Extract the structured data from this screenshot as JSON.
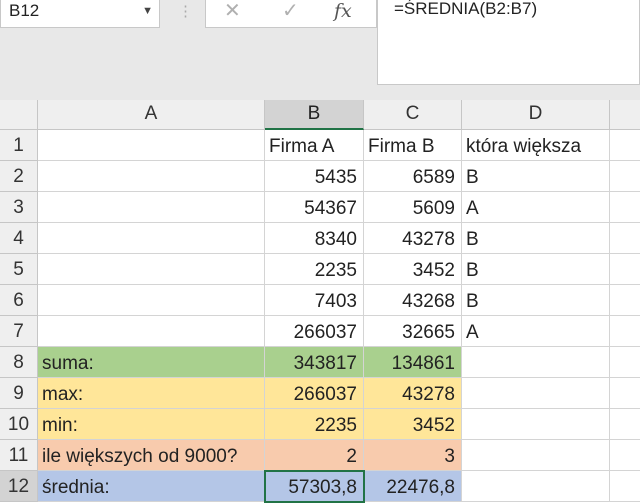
{
  "name_box": {
    "value": "B12"
  },
  "formula_bar": {
    "formula": "=ŚREDNIA(B2:B7)"
  },
  "icons": {
    "cancel": "close-icon",
    "enter": "check-icon",
    "function": "fx-icon",
    "dropdown": "chevron-down-icon"
  },
  "glyphs": {
    "cancel": "✕",
    "enter": "✓",
    "fx": "fx",
    "dropdown": "▼",
    "separator": "⋮"
  },
  "columns": [
    "A",
    "B",
    "C",
    "D"
  ],
  "row_numbers": [
    "1",
    "2",
    "3",
    "4",
    "5",
    "6",
    "7",
    "8",
    "9",
    "10",
    "11",
    "12"
  ],
  "rows": [
    [
      "",
      "Firma A",
      "Firma B",
      "która większa"
    ],
    [
      "",
      "5435",
      "6589",
      "B"
    ],
    [
      "",
      "54367",
      "5609",
      "A"
    ],
    [
      "",
      "8340",
      "43278",
      "B"
    ],
    [
      "",
      "2235",
      "3452",
      "B"
    ],
    [
      "",
      "7403",
      "43268",
      "B"
    ],
    [
      "",
      "266037",
      "32665",
      "A"
    ],
    [
      "suma:",
      "343817",
      "134861",
      ""
    ],
    [
      "max:",
      "266037",
      "43278",
      ""
    ],
    [
      "min:",
      "2235",
      "3452",
      ""
    ],
    [
      "ile większych od 9000?",
      "2",
      "3",
      ""
    ],
    [
      "średnia:",
      "57303,8",
      "22476,8",
      ""
    ]
  ],
  "row_fills": [
    "",
    "",
    "",
    "",
    "",
    "",
    "",
    "#a9d08e",
    "#ffe699",
    "#ffe699",
    "#f8cbad",
    "#b4c6e7"
  ],
  "active_cell": "B12",
  "colors": {
    "accent": "#217346",
    "suma": "#a9d08e",
    "max_min": "#ffe699",
    "count": "#f8cbad",
    "avg": "#b4c6e7"
  }
}
